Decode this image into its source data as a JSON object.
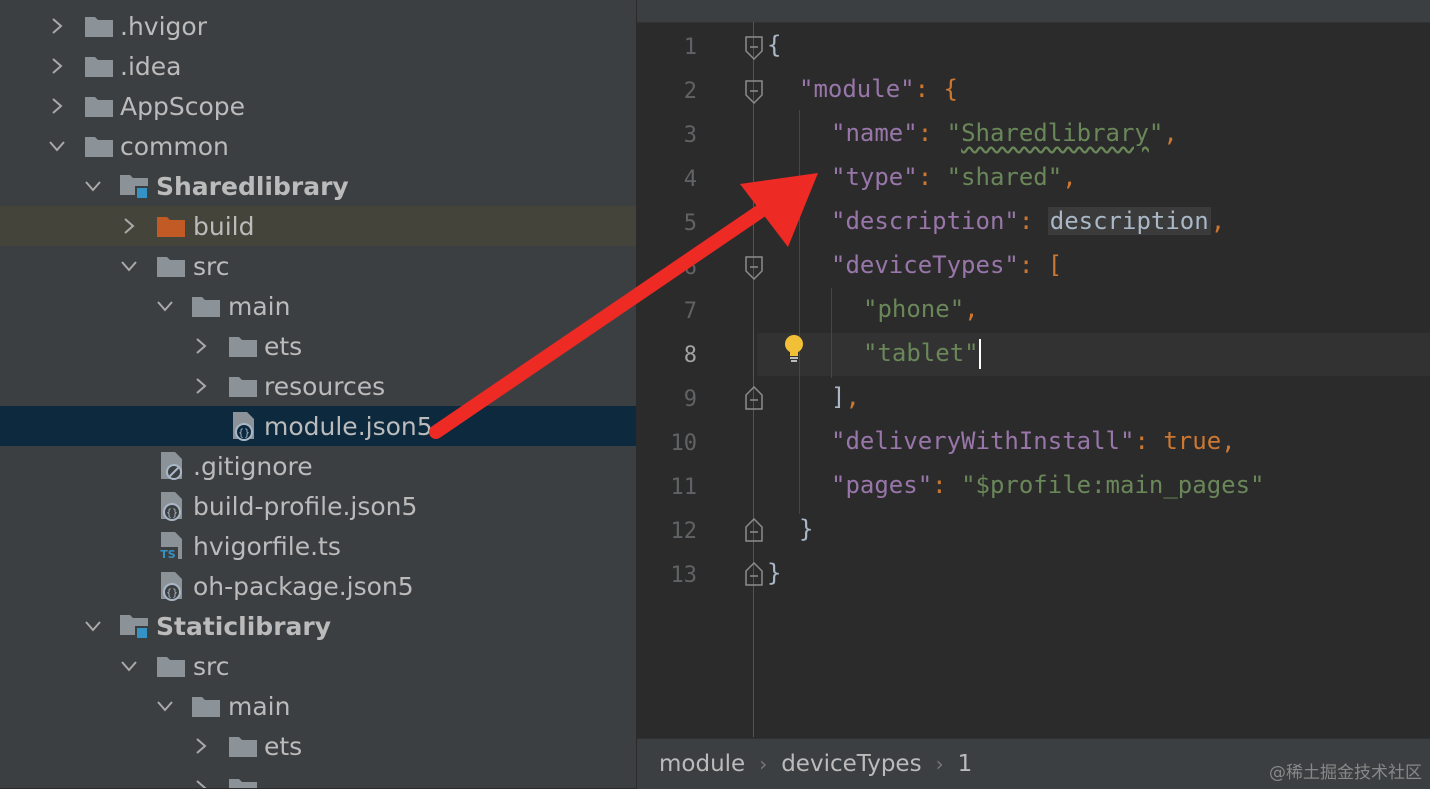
{
  "tree": {
    "items": [
      {
        "label": ".hvigor",
        "icon": "folder-icon",
        "expanded": false
      },
      {
        "label": ".idea",
        "icon": "folder-icon",
        "expanded": false
      },
      {
        "label": "AppScope",
        "icon": "folder-icon",
        "expanded": false
      },
      {
        "label": "common",
        "icon": "folder-icon",
        "expanded": true
      },
      {
        "label": "Sharedlibrary",
        "icon": "module-folder-icon",
        "expanded": true
      },
      {
        "label": "build",
        "icon": "excluded-folder-icon",
        "expanded": false
      },
      {
        "label": "src",
        "icon": "folder-icon",
        "expanded": true
      },
      {
        "label": "main",
        "icon": "folder-icon",
        "expanded": true
      },
      {
        "label": "ets",
        "icon": "folder-icon",
        "expanded": false
      },
      {
        "label": "resources",
        "icon": "folder-icon",
        "expanded": false
      },
      {
        "label": "module.json5",
        "icon": "json5-file-icon",
        "selected": true
      },
      {
        "label": ".gitignore",
        "icon": "gitignore-file-icon"
      },
      {
        "label": "build-profile.json5",
        "icon": "json5-file-icon"
      },
      {
        "label": "hvigorfile.ts",
        "icon": "typescript-file-icon"
      },
      {
        "label": "oh-package.json5",
        "icon": "json5-file-icon"
      },
      {
        "label": "Staticlibrary",
        "icon": "module-folder-icon",
        "expanded": true
      },
      {
        "label": "src",
        "icon": "folder-icon",
        "expanded": true
      },
      {
        "label": "main",
        "icon": "folder-icon",
        "expanded": true
      },
      {
        "label": "ets",
        "icon": "folder-icon",
        "expanded": false
      }
    ]
  },
  "editor": {
    "line_numbers": [
      "1",
      "2",
      "3",
      "4",
      "5",
      "6",
      "7",
      "8",
      "9",
      "10",
      "11",
      "12",
      "13"
    ],
    "active_line": "8",
    "tokens": {
      "l1_brace": "{",
      "l2_key": "\"module\"",
      "l2_rest": ": {",
      "l3_key": "\"name\"",
      "l3_colon": ": ",
      "l3_q1": "\"",
      "l3_val": "Sharedlibrary",
      "l3_q2": "\"",
      "l3_comma": ",",
      "l4_key": "\"type\"",
      "l4_colon": ": ",
      "l4_val": "\"shared\"",
      "l4_comma": ",",
      "l5_key": "\"description\"",
      "l5_colon": ": ",
      "l5_val": "description",
      "l5_comma": ",",
      "l6_key": "\"deviceTypes\"",
      "l6_rest": ": [",
      "l7_val": "\"phone\"",
      "l7_comma": ",",
      "l8_val": "\"tablet\"",
      "l9_close": "]",
      "l9_comma": ",",
      "l10_key": "\"deliveryWithInstall\"",
      "l10_colon": ": ",
      "l10_val": "true",
      "l10_comma": ",",
      "l11_key": "\"pages\"",
      "l11_colon": ": ",
      "l11_val": "\"$profile:main_pages\"",
      "l12_brace": "}",
      "l13_brace": "}"
    }
  },
  "breadcrumb": [
    "module",
    "deviceTypes",
    "1"
  ],
  "breadcrumb_separator": "›",
  "watermark": "@稀土掘金技术社区",
  "colors": {
    "tree_bg": "#3c3f41",
    "editor_bg": "#2b2b2b",
    "selection": "#0d293e",
    "json_key": "#9876aa",
    "json_string": "#6a8759",
    "keyword": "#cc7832",
    "arrow": "#ee2a24"
  }
}
